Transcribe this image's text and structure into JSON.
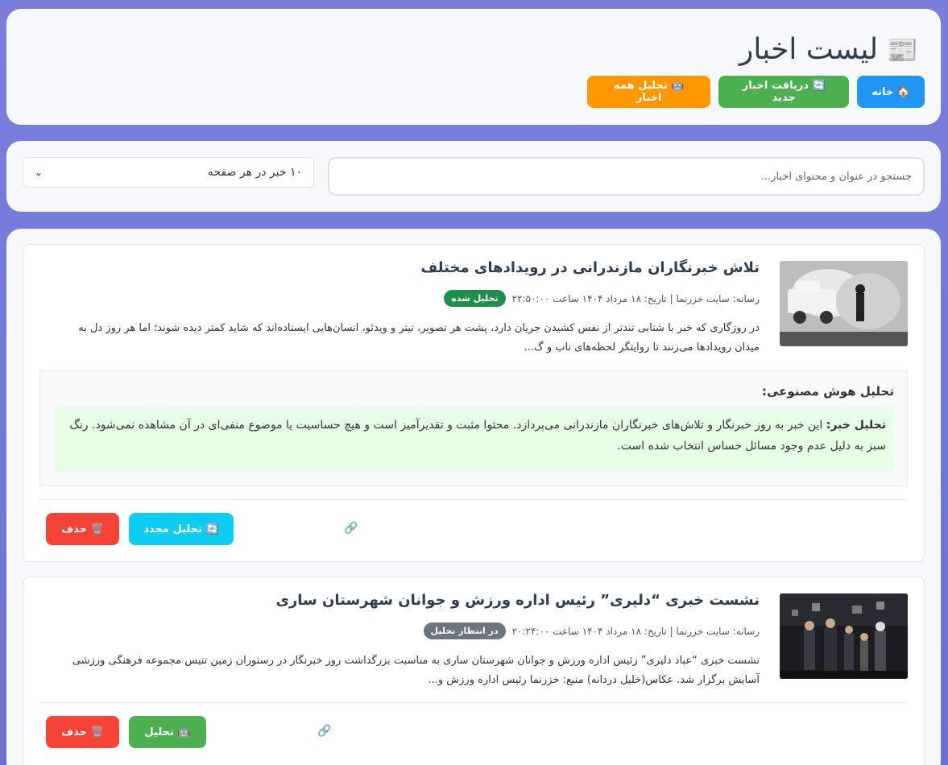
{
  "header": {
    "title": "لیست اخبار",
    "title_icon": "newspaper-icon",
    "buttons": {
      "home": "🏠 خانه",
      "fetch": "🔄 دریافت اخبار جدید",
      "analyze_all": "🤖 تحلیل همه اخبار"
    }
  },
  "search": {
    "placeholder": "جستجو در عنوان و محتوای اخبار...",
    "per_page": "۱۰ خبر در هر صفحه"
  },
  "news": [
    {
      "title": "تلاش خبرنگاران مازندرانی در رویدادهای مختلف",
      "meta": "رسانه: سایت خزرنما | تاریخ: ۱۸ مرداد ۱۴۰۴ ساعت ۲۲:۵۰:۰۰",
      "status": "تحلیل شده",
      "summary": "در روزگاری که خبر با شتابی تندتر از نفس کشیدن جریان دارد، پشت هر تصویر، تیتر و ویدئو، انسان‌هایی ایستاده‌اند که شاید کمتر دیده شوند؛ اما هر روز دل به میدان رویدادها می‌زنند تا روایتگر لحظه‌های ناب و گ...",
      "ai_title": "تحلیل هوش مصنوعی:",
      "ai_label": "تحلیل خبر:",
      "ai_text": "این خبر به روز خبرنگار و تلاش‌های خبرنگاران مازندرانی می‌پردازد. محتوا مثبت و تقدیرآمیز است و هیچ حساسیت یا موضوع منفی‌ای در آن مشاهده نمی‌شود. رنگ سبز به دلیل عدم وجود مسائل حساس انتخاب شده است.",
      "reanalyze": "🔄 تحلیل مجدد",
      "delete": "🗑️ حذف",
      "link_icon": "🔗"
    },
    {
      "title": "نشست خبری “دلیری” رئیس اداره ورزش و جوانان شهرستان ساری",
      "meta": "رسانه: سایت خزرنما | تاریخ: ۱۸ مرداد ۱۴۰۴ ساعت ۲۰:۲۴:۰۰",
      "status": "در انتظار تحلیل",
      "summary": "نشست خبری “عباد دلیری” رئیس اداره ورزش و جوانان شهرستان ساری به مناسبت بزرگداشت روز خبرنگار در رستوران زمین تنیس مجموعه فرهنگی ورزشی آسایش برگزار شد. عکاس(خلیل دردانه) منبع: خزرنما رئیس اداره ورزش و...",
      "analyze": "🤖 تحلیل",
      "delete": "🗑️ حذف",
      "link_icon": "🔗"
    }
  ]
}
